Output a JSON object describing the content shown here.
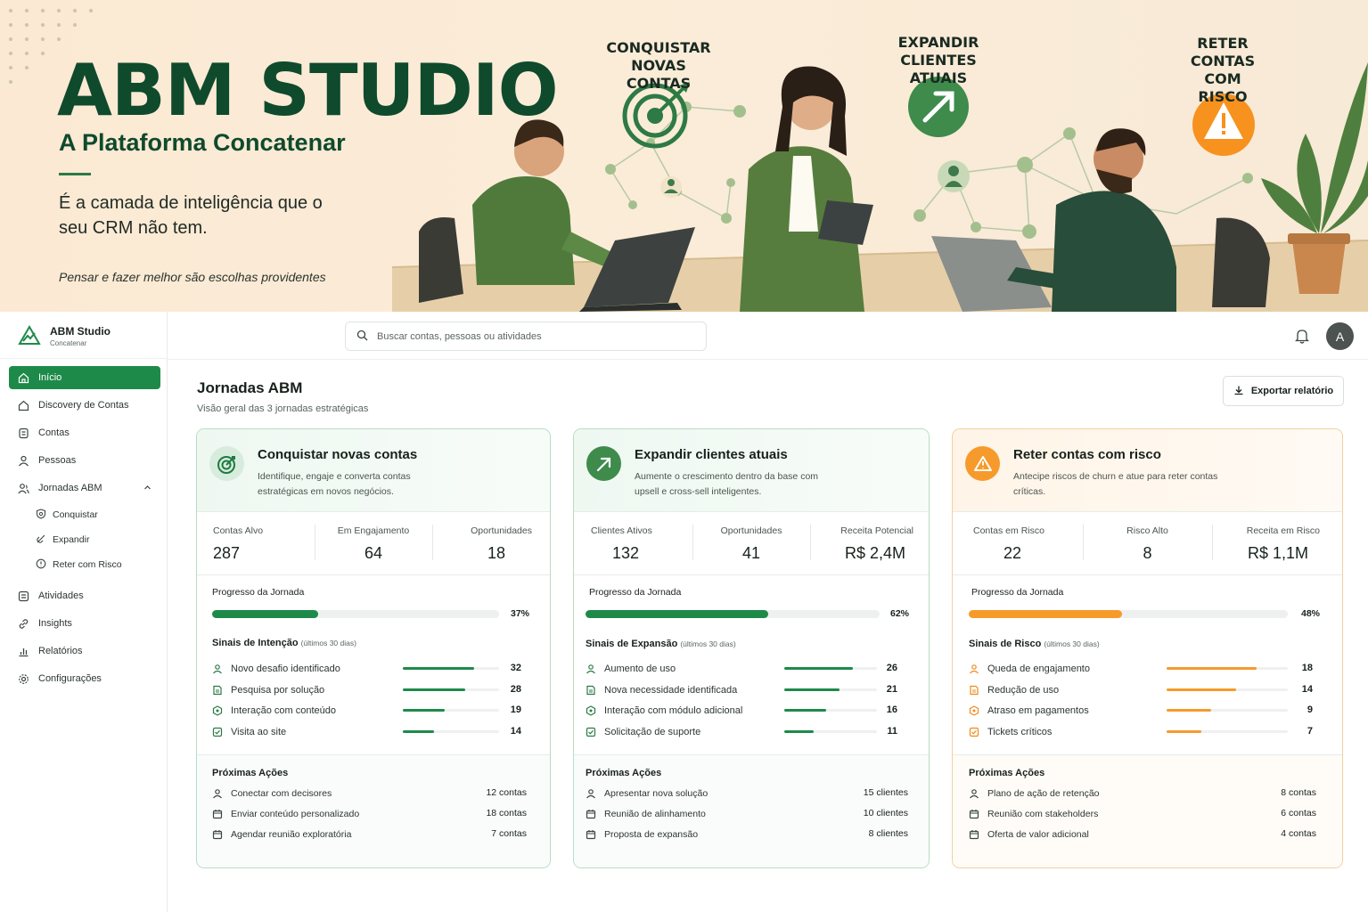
{
  "hero": {
    "title": "ABM STUDIO",
    "subtitle": "A Plataforma Concatenar",
    "tagline": "É a camada de inteligência que o seu CRM não tem.",
    "motto": "Pensar e fazer melhor são escolhas providentes",
    "labels": {
      "conquistar": "CONQUISTAR NOVAS CONTAS",
      "expandir": "EXPANDIR CLIENTES ATUAIS",
      "reter": "RETER CONTAS COM RISCO"
    }
  },
  "brand": {
    "name": "ABM Studio",
    "sub": "Concatenar"
  },
  "nav": {
    "items": [
      {
        "label": "Início"
      },
      {
        "label": "Discovery de Contas"
      },
      {
        "label": "Contas"
      },
      {
        "label": "Pessoas"
      },
      {
        "label": "Jornadas ABM"
      }
    ],
    "subitems": [
      {
        "label": "Conquistar"
      },
      {
        "label": "Expandir"
      },
      {
        "label": "Reter com Risco"
      }
    ],
    "bottom": [
      {
        "label": "Atividades"
      },
      {
        "label": "Insights"
      },
      {
        "label": "Relatórios"
      },
      {
        "label": "Configurações"
      }
    ]
  },
  "search": {
    "placeholder": "Buscar contas, pessoas ou atividades"
  },
  "user": {
    "initial": "A"
  },
  "page": {
    "title": "Jornadas ABM",
    "subtitle": "Visão geral das 3 jornadas estratégicas",
    "export_label": "Exportar relatório"
  },
  "colors": {
    "green": "#1e8a4a",
    "orange": "#f79a2c",
    "dark_green": "#0f4a2c"
  },
  "cards": [
    {
      "title": "Conquistar novas contas",
      "desc": "Identifique, engaje e converta contas estratégicas em novos negócios.",
      "metrics": [
        {
          "label": "Contas Alvo",
          "value": "287"
        },
        {
          "label": "Em Engajamento",
          "value": "64"
        },
        {
          "label": "Oportunidades",
          "value": "18"
        }
      ],
      "progress_label": "Progresso da Jornada",
      "progress": 37,
      "progress_text": "37%",
      "signals_title": "Sinais de Intenção",
      "signals_period": "(últimos 30 dias)",
      "signals": [
        {
          "label": "Novo desafio identificado",
          "value": 32
        },
        {
          "label": "Pesquisa por solução",
          "value": 28
        },
        {
          "label": "Interação com conteúdo",
          "value": 19
        },
        {
          "label": "Visita ao site",
          "value": 14
        }
      ],
      "actions_title": "Próximas Ações",
      "actions": [
        {
          "label": "Conectar com decisores",
          "value": "12 contas"
        },
        {
          "label": "Enviar conteúdo personalizado",
          "value": "18 contas"
        },
        {
          "label": "Agendar reunião exploratória",
          "value": "7 contas"
        }
      ]
    },
    {
      "title": "Expandir clientes atuais",
      "desc": "Aumente o crescimento dentro da base com upsell e cross-sell inteligentes.",
      "metrics": [
        {
          "label": "Clientes Ativos",
          "value": "132"
        },
        {
          "label": "Oportunidades",
          "value": "41"
        },
        {
          "label": "Receita Potencial",
          "value": "R$ 2,4M"
        }
      ],
      "progress_label": "Progresso da Jornada",
      "progress": 62,
      "progress_text": "62%",
      "signals_title": "Sinais de Expansão",
      "signals_period": "(últimos 30 dias)",
      "signals": [
        {
          "label": "Aumento de uso",
          "value": 26
        },
        {
          "label": "Nova necessidade identificada",
          "value": 21
        },
        {
          "label": "Interação com módulo adicional",
          "value": 16
        },
        {
          "label": "Solicitação de suporte",
          "value": 11
        }
      ],
      "actions_title": "Próximas Ações",
      "actions": [
        {
          "label": "Apresentar nova solução",
          "value": "15 clientes"
        },
        {
          "label": "Reunião de alinhamento",
          "value": "10 clientes"
        },
        {
          "label": "Proposta de expansão",
          "value": "8 clientes"
        }
      ]
    },
    {
      "title": "Reter contas com risco",
      "desc": "Antecipe riscos de churn e atue para reter contas críticas.",
      "metrics": [
        {
          "label": "Contas em Risco",
          "value": "22"
        },
        {
          "label": "Risco Alto",
          "value": "8"
        },
        {
          "label": "Receita em Risco",
          "value": "R$ 1,1M"
        }
      ],
      "progress_label": "Progresso da Jornada",
      "progress": 48,
      "progress_text": "48%",
      "signals_title": "Sinais de Risco",
      "signals_period": "(últimos 30 dias)",
      "signals": [
        {
          "label": "Queda de engajamento",
          "value": 18
        },
        {
          "label": "Redução de uso",
          "value": 14
        },
        {
          "label": "Atraso em pagamentos",
          "value": 9
        },
        {
          "label": "Tickets críticos",
          "value": 7
        }
      ],
      "actions_title": "Próximas Ações",
      "actions": [
        {
          "label": "Plano de ação de retenção",
          "value": "8 contas"
        },
        {
          "label": "Reunião com stakeholders",
          "value": "6 contas"
        },
        {
          "label": "Oferta de valor adicional",
          "value": "4 contas"
        }
      ]
    }
  ]
}
